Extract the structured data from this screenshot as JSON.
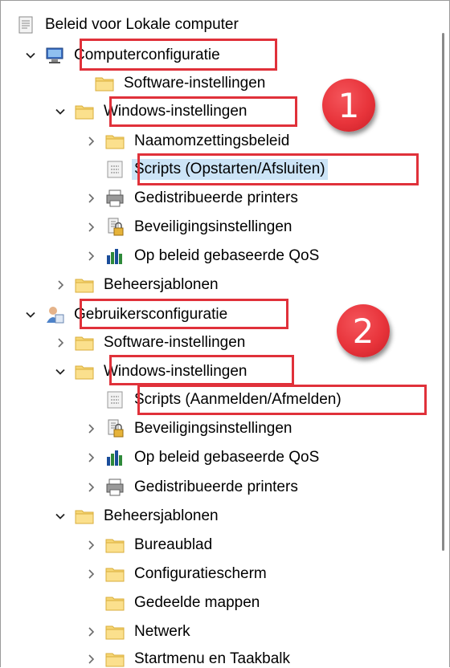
{
  "tree": {
    "root": {
      "label": "Beleid voor Lokale computer",
      "icon": "policy-document-icon"
    },
    "computer": {
      "label": "Computerconfiguratie",
      "icon": "computer-config-icon",
      "software": "Software-instellingen",
      "windows": "Windows-instellingen",
      "naam": "Naamomzettingsbeleid",
      "scripts": "Scripts (Opstarten/Afsluiten)",
      "printers": "Gedistribueerde printers",
      "security": "Beveiligingsinstellingen",
      "qos": "Op beleid gebaseerde QoS",
      "templates": "Beheersjablonen"
    },
    "user": {
      "label": "Gebruikersconfiguratie",
      "icon": "user-config-icon",
      "software": "Software-instellingen",
      "windows": "Windows-instellingen",
      "scripts": "Scripts (Aanmelden/Afmelden)",
      "security": "Beveiligingsinstellingen",
      "qos": "Op beleid gebaseerde QoS",
      "printers": "Gedistribueerde printers",
      "templates": "Beheersjablonen",
      "desktop": "Bureaublad",
      "control": "Configuratiescherm",
      "shared": "Gedeelde mappen",
      "network": "Netwerk",
      "start": "Startmenu en Taakbalk"
    }
  },
  "annotations": {
    "badge1": "1",
    "badge2": "2"
  },
  "colors": {
    "highlight": "#e0313a",
    "selection": "#cce4f7",
    "folder": "#f3cf6a"
  }
}
